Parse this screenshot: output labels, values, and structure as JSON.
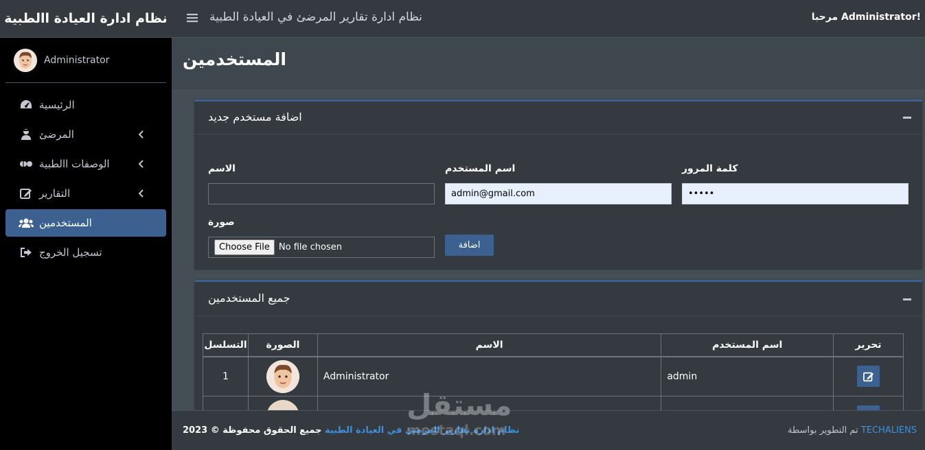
{
  "app": {
    "brand_title": "نظام ادارة العيادة االطبية"
  },
  "user_panel": {
    "name": "Administrator"
  },
  "header": {
    "title": "نظام ادارة تقارير المرضئ في العيادة الطبية",
    "welcome": "مرحبا Administrator!"
  },
  "sidebar": {
    "items": [
      {
        "label": "الرئيسية",
        "icon": "dashboard-icon"
      },
      {
        "label": "المرضئ",
        "icon": "user-injured-icon"
      },
      {
        "label": "الوصفات االطبية",
        "icon": "pills-icon"
      },
      {
        "label": "التقارير",
        "icon": "edit-icon"
      },
      {
        "label": "المستخدمين",
        "icon": "users-icon"
      },
      {
        "label": "تسجيل الخروج",
        "icon": "sign-out-icon"
      }
    ]
  },
  "page": {
    "title": "المستخدمين"
  },
  "add_user_card": {
    "title": "اضافة مستخدم جديد",
    "name_label": "الاسم",
    "name_value": "",
    "username_label": "اسم المستخدم",
    "username_value": "admin@gmail.com",
    "password_label": "كلمة المرور",
    "password_value": "•••••",
    "image_label": "صورة",
    "file_button": "Choose File",
    "file_status": "No file chosen",
    "submit_label": "اضافة"
  },
  "users_card": {
    "title": "جميع المستخدمين",
    "columns": [
      "التسلسل",
      "الصورة",
      "الاسم",
      "اسم المستخدم",
      "تحرير"
    ],
    "rows": [
      {
        "index": "1",
        "name": "Administrator",
        "username": "admin"
      }
    ]
  },
  "footer": {
    "copyright_prefix": "جميع الحقوق محفوظة © 2023",
    "copyright_link": "نظام ادارة تقارير المرضئ في العيادة الطبية",
    "dev_prefix": "تم التطوير بواسطة",
    "dev_link": "TECHALIENS"
  },
  "watermark": {
    "text": "مستقل",
    "sub": "mostaql.com"
  },
  "colors": {
    "accent": "#3c6191",
    "sidebar_bg": "#000000",
    "page_bg": "#454d55",
    "card_bg": "#343a40",
    "link": "#3f8fdc"
  }
}
